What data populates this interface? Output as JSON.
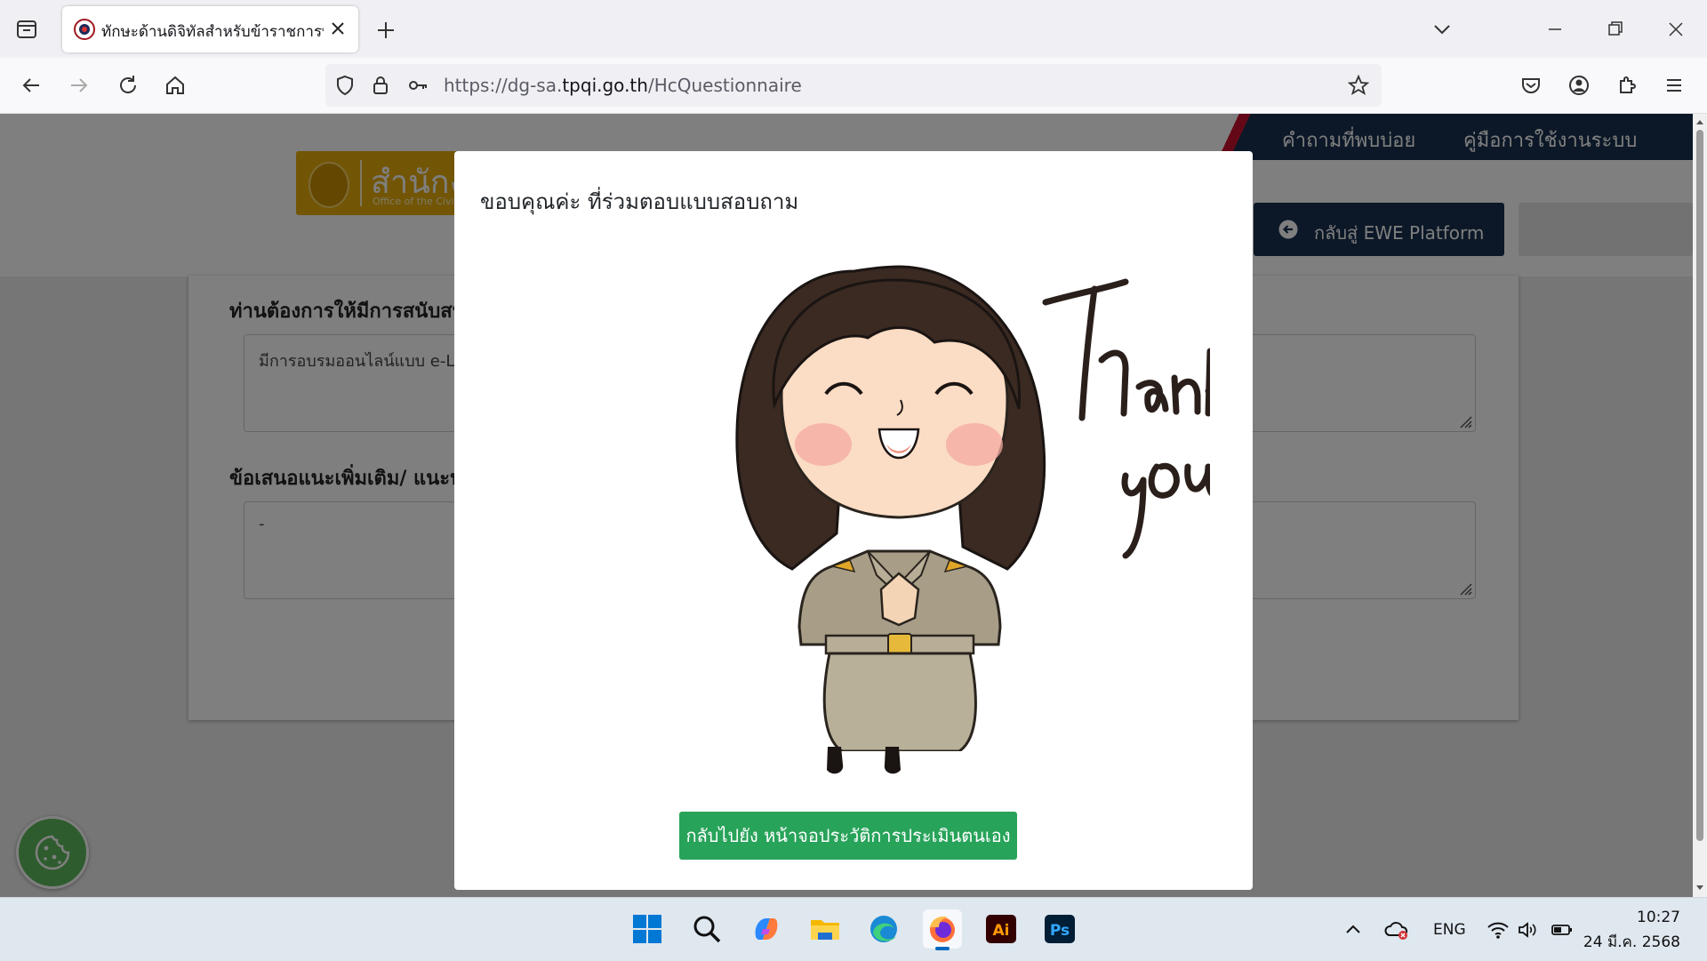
{
  "browser": {
    "tab": {
      "title": "ทักษะด้านดิจิทัลสำหรับข้าราชการพ",
      "favicon": "ocsc-seal-icon"
    },
    "url": {
      "prefix": "https://dg-sa.",
      "domain": "tpqi.go.th",
      "path": "/HcQuestionnaire"
    }
  },
  "page": {
    "logo": {
      "text": "สำนักงาน",
      "sub": "Office of the Civil Service Commission"
    },
    "topnav": [
      {
        "label": "คำถามที่พบบ่อย"
      },
      {
        "label": "คู่มือการใช้งานระบบ"
      }
    ],
    "back_button": {
      "label": "กลับสู่ EWE Platform",
      "icon": "arrow-left-circle-icon"
    },
    "questions": [
      {
        "label": "ท่านต้องการให้มีการสนับสนุน",
        "value": "มีการอบรมออนไลน์แบบ e-Learning"
      },
      {
        "label": "ข้อเสนอแนะเพิ่มเติม/ แนะนำ",
        "value": "-"
      }
    ]
  },
  "modal": {
    "title": "ขอบคุณค่ะ ที่ร่วมตอบแบบสอบถาม",
    "image_text": "Thank you",
    "action_label": "กลับไปยัง หน้าจอประวัติการประเมินตนเอง",
    "action_color": "#28a35a"
  },
  "taskbar": {
    "apps": [
      {
        "name": "start",
        "icon": "windows-logo-icon"
      },
      {
        "name": "search",
        "icon": "search-icon"
      },
      {
        "name": "copilot",
        "icon": "copilot-icon"
      },
      {
        "name": "file-explorer",
        "icon": "folder-icon"
      },
      {
        "name": "edge",
        "icon": "edge-icon"
      },
      {
        "name": "firefox",
        "icon": "firefox-icon"
      },
      {
        "name": "illustrator",
        "icon": "illustrator-icon",
        "label": "Ai"
      },
      {
        "name": "photoshop",
        "icon": "photoshop-icon",
        "label": "Ps"
      }
    ],
    "tray": {
      "language": "ENG",
      "time": "10:27",
      "date": "24 มี.ค. 2568"
    }
  }
}
